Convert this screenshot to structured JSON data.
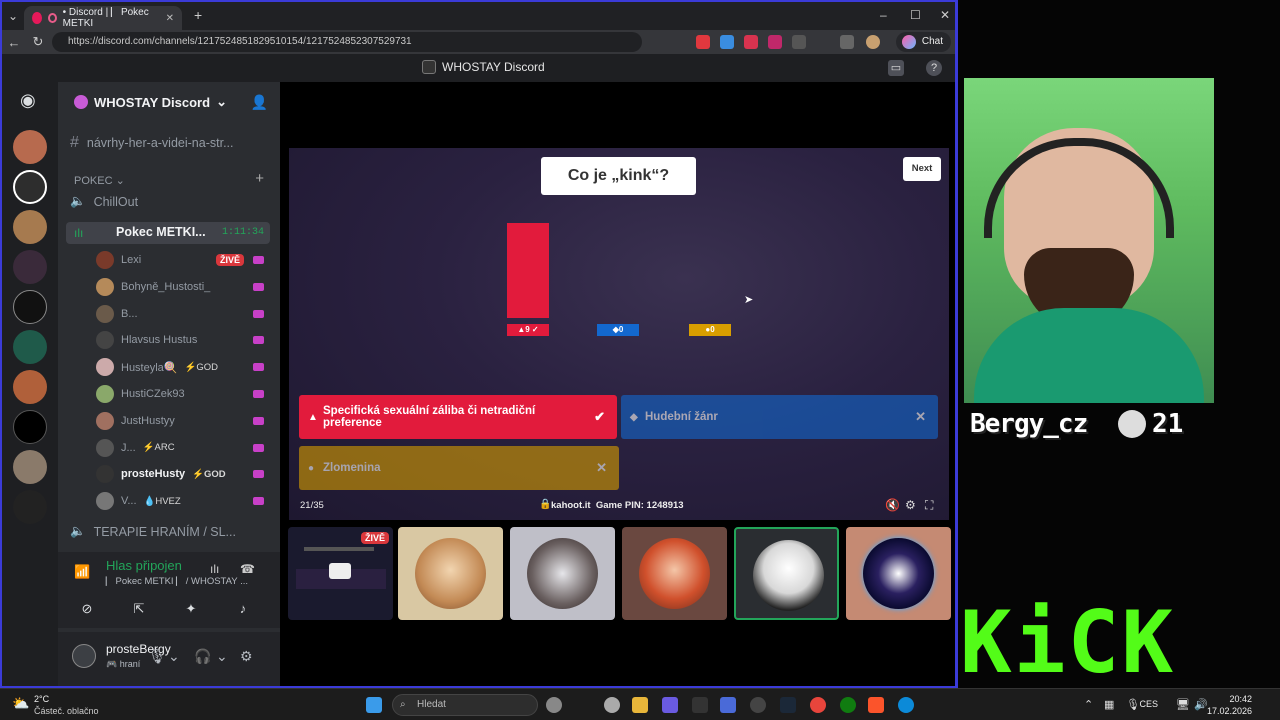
{
  "browser": {
    "tab_title": "• Discord | ⎸Pokec METKI",
    "url": "https://discord.com/channels/1217524851829510154/1217524852307529731",
    "chat_label": "Chat"
  },
  "discord": {
    "window_title": "WHOSTAY Discord",
    "server_name": "WHOSTAY Discord",
    "channels": {
      "text_channel": "návrhy-her-a-videi-na-str...",
      "category": "POKEC",
      "chillout": "ChillOut",
      "active": "Pokec METKI...",
      "active_timer": "1:11:34",
      "terapie": "TERAPIE HRANÍM / SL..."
    },
    "voice_users": [
      {
        "name": "Lexi",
        "badge": "",
        "live": "ŽIVĚ",
        "color": "#7a3a2a"
      },
      {
        "name": "Bohyně_Hustosti_",
        "badge": "",
        "live": "",
        "color": "#b58a5a"
      },
      {
        "name": "B...",
        "badge": "",
        "live": "",
        "color": "#6a5a4a"
      },
      {
        "name": "Hlavsus Hustus",
        "badge": "",
        "live": "",
        "color": "#444"
      },
      {
        "name": "Husteyla🍭",
        "badge": "⚡GOD",
        "live": "",
        "color": "#caa"
      },
      {
        "name": "HustiCZek93",
        "badge": "",
        "live": "",
        "color": "#8aa86a"
      },
      {
        "name": "JustHustyy",
        "badge": "",
        "live": "",
        "color": "#a07060"
      },
      {
        "name": "J...",
        "badge": "⚡ARC",
        "live": "",
        "color": "#555"
      },
      {
        "name": "prosteHusty",
        "badge": "⚡GOD",
        "live": "",
        "color": "#333"
      },
      {
        "name": "V...",
        "badge": "💧HVEZ",
        "live": "",
        "color": "#777"
      }
    ],
    "voice_panel": {
      "status": "Hlas připojen",
      "sub": "⎸Pokec METKI ⎸/ WHOSTAY ..."
    },
    "user_panel": {
      "name": "prosteBergy",
      "status": "🎮 hraní"
    }
  },
  "kahoot": {
    "question": "Co je „kink“?",
    "next_label": "Next",
    "bars": [
      {
        "shape": "▲",
        "count": 9,
        "correct": true,
        "color": "#e21b3c",
        "label": "▲9 ✓"
      },
      {
        "shape": "◆",
        "count": 0,
        "correct": false,
        "color": "#1368ce",
        "label": "◆0"
      },
      {
        "shape": "●",
        "count": 0,
        "correct": false,
        "color": "#d89e00",
        "label": "●0"
      }
    ],
    "answers": [
      {
        "sym": "▲",
        "text": "Specifická sexuální záliba či netradiční preference",
        "mark": "✔",
        "color": "#e21b3c"
      },
      {
        "sym": "◆",
        "text": "Hudební žánr",
        "mark": "✕",
        "color": "#1368ce"
      },
      {
        "sym": "●",
        "text": "Zlomenina",
        "mark": "✕",
        "color": "#d89e00"
      }
    ],
    "progress": "21/35",
    "site": "kahoot.it",
    "pin": "Game PIN: 1248913"
  },
  "stream_tiles": {
    "live_label": "ŽIVĚ"
  },
  "overlay": {
    "name": "Bergy_cz",
    "score": "21",
    "brand": "KiCK",
    "accent": "#53fc18"
  },
  "taskbar": {
    "temp": "2°C",
    "weather": "Částeč. oblačno",
    "search_placeholder": "Hledat",
    "lang": "CES",
    "time": "20:42",
    "date": "17.02.2026"
  }
}
